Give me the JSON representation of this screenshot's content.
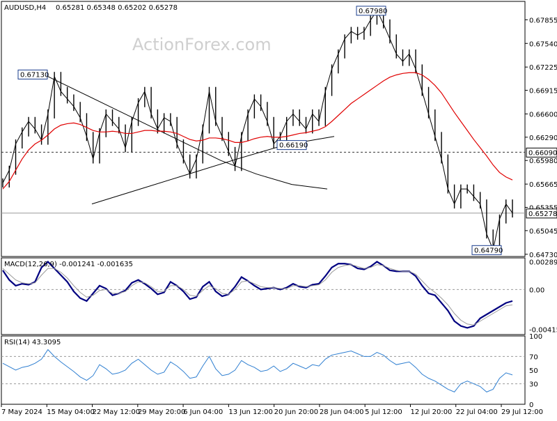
{
  "header": {
    "symbol": "AUDUSD,H4",
    "ohlc": "0.65281 0.65348 0.65202 0.65278"
  },
  "watermark": "ActionForex.com",
  "chart_data": [
    {
      "type": "line",
      "name": "price",
      "ylim": [
        0.647,
        0.681
      ],
      "y_ticks": [
        "0.67855",
        "0.67540",
        "0.67225",
        "0.66915",
        "0.66600",
        "0.66290",
        "0.65980",
        "0.65665",
        "0.65355",
        "0.65045",
        "0.64730"
      ],
      "current_price": "0.65278",
      "level_line": "0.66090",
      "annotations": [
        "0.67130",
        "0.67980",
        "0.66190",
        "0.64790"
      ],
      "x_ticks": [
        "7 May 2024",
        "15 May 04:00",
        "22 May 12:00",
        "29 May 20:00",
        "6 Jun 04:00",
        "13 Jun 12:00",
        "20 Jun 20:00",
        "28 Jun 04:00",
        "5 Jul 12:00",
        "12 Jul 20:00",
        "22 Jul 04:00",
        "29 Jul 12:00"
      ],
      "series": [
        {
          "values": [
            0.6568,
            0.6585,
            0.662,
            0.6636,
            0.665,
            0.664,
            0.6625,
            0.666,
            0.671,
            0.669,
            0.668,
            0.667,
            0.6655,
            0.663,
            0.66,
            0.6635,
            0.666,
            0.665,
            0.664,
            0.6615,
            0.665,
            0.6675,
            0.669,
            0.666,
            0.664,
            0.6655,
            0.665,
            0.662,
            0.66,
            0.658,
            0.66,
            0.664,
            0.669,
            0.665,
            0.663,
            0.661,
            0.659,
            0.663,
            0.666,
            0.668,
            0.667,
            0.665,
            0.662,
            0.663,
            0.665,
            0.666,
            0.665,
            0.664,
            0.666,
            0.665,
            0.669,
            0.672,
            0.674,
            0.676,
            0.677,
            0.6765,
            0.677,
            0.6785,
            0.6798,
            0.678,
            0.676,
            0.674,
            0.673,
            0.674,
            0.672,
            0.669,
            0.666,
            0.663,
            0.66,
            0.656,
            0.654,
            0.656,
            0.656,
            0.655,
            0.654,
            0.65,
            0.6479,
            0.652,
            0.654,
            0.6528
          ]
        },
        {
          "values": [
            0.656,
            0.657,
            0.6585,
            0.66,
            0.6612,
            0.662,
            0.6625,
            0.6632,
            0.664,
            0.6645,
            0.6647,
            0.6648,
            0.6646,
            0.6642,
            0.6638,
            0.6636,
            0.6636,
            0.6637,
            0.6636,
            0.6634,
            0.6634,
            0.6636,
            0.6638,
            0.6638,
            0.6637,
            0.6637,
            0.6636,
            0.6634,
            0.663,
            0.6626,
            0.6624,
            0.6625,
            0.6628,
            0.6628,
            0.6627,
            0.6625,
            0.6622,
            0.6622,
            0.6624,
            0.6627,
            0.6629,
            0.663,
            0.6629,
            0.6629,
            0.663,
            0.6632,
            0.6634,
            0.6635,
            0.6637,
            0.6639,
            0.6643,
            0.665,
            0.6658,
            0.6666,
            0.6674,
            0.668,
            0.6686,
            0.6692,
            0.6698,
            0.6704,
            0.6709,
            0.6712,
            0.6714,
            0.6715,
            0.6715,
            0.6712,
            0.6706,
            0.6698,
            0.6688,
            0.6675,
            0.6662,
            0.665,
            0.6638,
            0.6626,
            0.6615,
            0.6604,
            0.6592,
            0.6582,
            0.6576,
            0.6572
          ]
        },
        {
          "values": [
            0.6713,
            0.669,
            0.6667,
            0.6644,
            0.6621,
            0.6598,
            0.658,
            0.6566,
            0.656
          ]
        },
        {
          "values": [
            0.654,
            0.656,
            0.658,
            0.66,
            0.6619,
            0.663
          ]
        }
      ]
    },
    {
      "type": "line",
      "title": "MACD(12,26,9) -0.001241 -0.001635",
      "ylim": [
        -0.0047,
        0.0033
      ],
      "y_ticks": [
        "0.002899",
        "0.00",
        "-0.004158"
      ],
      "series": [
        {
          "values": [
            0.002,
            0.001,
            0.0004,
            0.0006,
            0.0005,
            0.0008,
            0.0023,
            0.0029,
            0.0022,
            0.0015,
            0.0008,
            -0.0002,
            -0.0009,
            -0.0012,
            -0.0004,
            0.0004,
            0.0001,
            -0.0006,
            -0.0004,
            -0.0001,
            0.0007,
            0.001,
            0.0006,
            0.0001,
            -0.0005,
            -0.0003,
            0.0008,
            0.0004,
            -0.0002,
            -0.001,
            -0.0008,
            0.0003,
            0.0008,
            -0.0002,
            -0.0007,
            -0.0005,
            0.0003,
            0.0013,
            0.0009,
            0.0004,
            0.0,
            0.0001,
            0.0002,
            0.0,
            0.0002,
            0.0006,
            0.0003,
            0.0002,
            0.0005,
            0.0006,
            0.0014,
            0.0023,
            0.0027,
            0.0027,
            0.0026,
            0.0022,
            0.0021,
            0.0024,
            0.0029,
            0.0025,
            0.002,
            0.0019,
            0.0019,
            0.0019,
            0.0014,
            0.0004,
            -0.0004,
            -0.0006,
            -0.0014,
            -0.0022,
            -0.0033,
            -0.0038,
            -0.004,
            -0.0038,
            -0.003,
            -0.0026,
            -0.0022,
            -0.0018,
            -0.0014,
            -0.0012
          ]
        },
        {
          "values": [
            0.0022,
            0.0016,
            0.001,
            0.0007,
            0.0006,
            0.0007,
            0.0015,
            0.0022,
            0.0022,
            0.0018,
            0.0012,
            0.0004,
            -0.0003,
            -0.0008,
            -0.0006,
            -0.0001,
            0.0,
            -0.0004,
            -0.0004,
            -0.0002,
            0.0004,
            0.0008,
            0.0007,
            0.0003,
            -0.0002,
            -0.0002,
            0.0004,
            0.0004,
            0.0,
            -0.0006,
            -0.0007,
            -0.0001,
            0.0004,
            0.0001,
            -0.0004,
            -0.0005,
            0.0,
            0.0008,
            0.0009,
            0.0006,
            0.0003,
            0.0002,
            0.0002,
            0.0001,
            0.0001,
            0.0004,
            0.0004,
            0.0003,
            0.0004,
            0.0005,
            0.001,
            0.0018,
            0.0023,
            0.0025,
            0.0026,
            0.0024,
            0.0022,
            0.0023,
            0.0026,
            0.0025,
            0.0022,
            0.002,
            0.0019,
            0.0019,
            0.0016,
            0.0009,
            0.0002,
            -0.0003,
            -0.0009,
            -0.0016,
            -0.0025,
            -0.0032,
            -0.0036,
            -0.0037,
            -0.0033,
            -0.0029,
            -0.0025,
            -0.0021,
            -0.0017,
            -0.0016
          ]
        }
      ]
    },
    {
      "type": "line",
      "title": "RSI(14) 43.3095",
      "ylim": [
        0,
        100
      ],
      "y_ticks": [
        "100",
        "70",
        "50",
        "30",
        "0"
      ],
      "series": [
        {
          "values": [
            60,
            55,
            50,
            54,
            56,
            60,
            66,
            80,
            70,
            62,
            55,
            48,
            40,
            35,
            42,
            58,
            52,
            44,
            46,
            50,
            60,
            66,
            58,
            50,
            44,
            47,
            62,
            56,
            48,
            38,
            40,
            56,
            70,
            52,
            42,
            44,
            50,
            64,
            58,
            54,
            48,
            50,
            56,
            48,
            52,
            60,
            56,
            52,
            58,
            56,
            66,
            72,
            74,
            76,
            78,
            74,
            70,
            70,
            76,
            72,
            64,
            58,
            60,
            62,
            54,
            44,
            38,
            34,
            28,
            22,
            18,
            30,
            34,
            30,
            26,
            18,
            22,
            38,
            46,
            43
          ]
        }
      ]
    }
  ]
}
